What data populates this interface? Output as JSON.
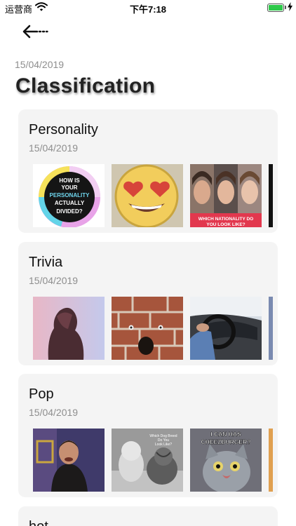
{
  "status_bar": {
    "carrier": "运营商",
    "time": "下午7:18",
    "battery_level": 1.0
  },
  "nav": {
    "back_icon": "back-arrow-icon"
  },
  "header": {
    "date": "15/04/2019",
    "title": "Classification"
  },
  "categories": [
    {
      "title": "Personality",
      "date": "15/04/2019",
      "thumbnails": [
        {
          "name": "personality-quiz-thumb",
          "text": "HOW IS YOUR PERSONALITY ACTUALLY DIVIDED?"
        },
        {
          "name": "heart-eyes-emoji-thumb"
        },
        {
          "name": "faces-nationality-thumb",
          "text": "WHICH NATIONALITY DO YOU LOOK LIKE?"
        },
        {
          "name": "partial-thumb"
        }
      ]
    },
    {
      "title": "Trivia",
      "date": "15/04/2019",
      "thumbnails": [
        {
          "name": "woman-silhouette-thumb"
        },
        {
          "name": "brick-face-thumb"
        },
        {
          "name": "car-driving-thumb"
        },
        {
          "name": "partial-thumb"
        }
      ]
    },
    {
      "title": "Pop",
      "date": "15/04/2019",
      "thumbnails": [
        {
          "name": "tv-actor-thumb"
        },
        {
          "name": "baby-dog-thumb",
          "text": "Which Dog Breed Do You Look Like?"
        },
        {
          "name": "cheezburger-cat-thumb",
          "text": "I CAN HAS CHEEZBURGER?"
        },
        {
          "name": "partial-thumb"
        }
      ]
    },
    {
      "title": "hot",
      "date": "",
      "thumbnails": []
    }
  ]
}
